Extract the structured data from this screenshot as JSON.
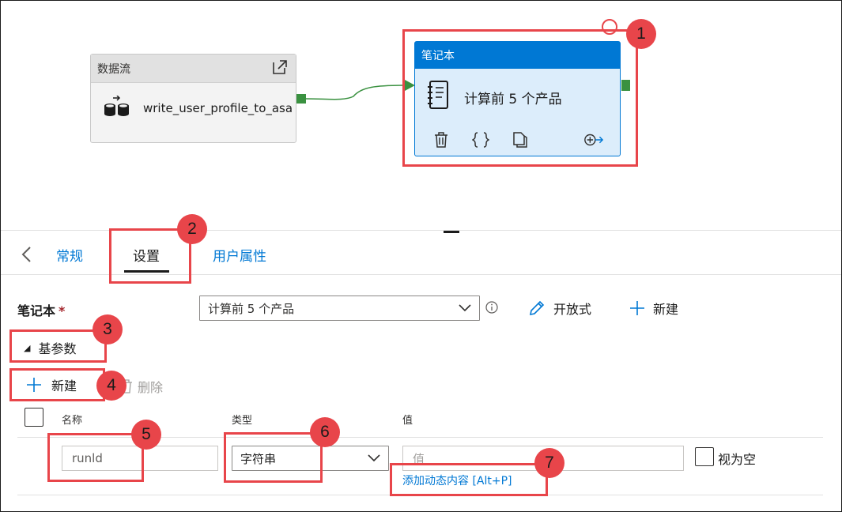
{
  "canvas": {
    "dataflow_node": {
      "header": "数据流",
      "name": "write_user_profile_to_asa"
    },
    "notebook_node": {
      "header": "笔记本",
      "name": "计算前 5 个产品"
    }
  },
  "tabs": {
    "general": "常规",
    "settings": "设置",
    "user_properties": "用户属性"
  },
  "settings": {
    "notebook_label": "笔记本",
    "required_mark": "*",
    "notebook_value": "计算前 5 个产品",
    "open_label": "开放式",
    "new_label": "新建",
    "base_params_label": "基参数",
    "add_label": "新建",
    "delete_label": "删除",
    "columns": {
      "name": "名称",
      "type": "类型",
      "value": "值"
    },
    "row": {
      "name": "runld",
      "type": "字符串",
      "value_placeholder": "值",
      "dynamic_link": "添加动态内容 [Alt+P]",
      "null_label": "视为空"
    }
  },
  "callouts": [
    "1",
    "2",
    "3",
    "4",
    "5",
    "6",
    "7"
  ],
  "colors": {
    "accent": "#0078d4",
    "callout": "#e8454a",
    "port": "#3a9140"
  }
}
